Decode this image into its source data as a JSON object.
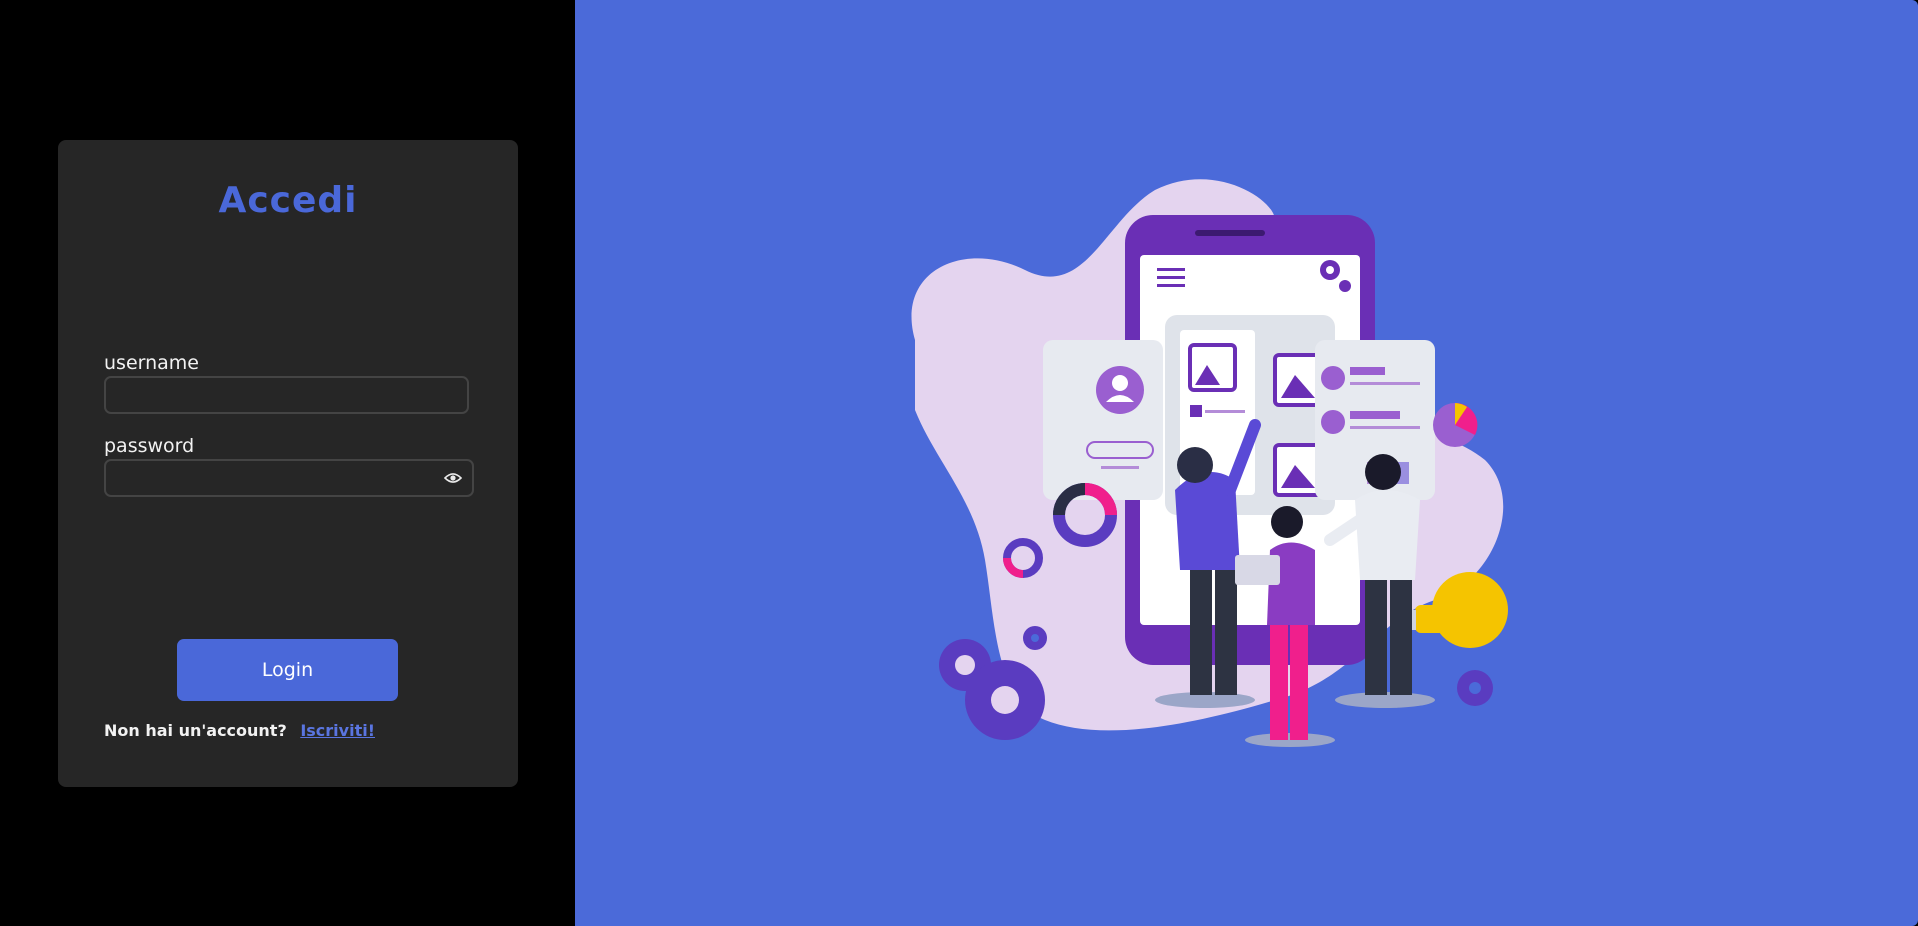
{
  "login": {
    "title": "Accedi",
    "username_label": "username",
    "username_value": "",
    "password_label": "password",
    "password_value": "",
    "login_button": "Login",
    "signup_prompt": "Non hai un'account?",
    "signup_link": "Iscriviti!"
  },
  "colors": {
    "accent": "#4a68d9",
    "card_bg": "#262626",
    "page_bg": "#000000",
    "hero_bg": "#4b6ad9",
    "blob": "#e4d4ef",
    "phone": "#6a2fb5",
    "magenta": "#f01f8c",
    "bulb": "#f5c400"
  },
  "icons": {
    "password_toggle": "eye-icon"
  }
}
